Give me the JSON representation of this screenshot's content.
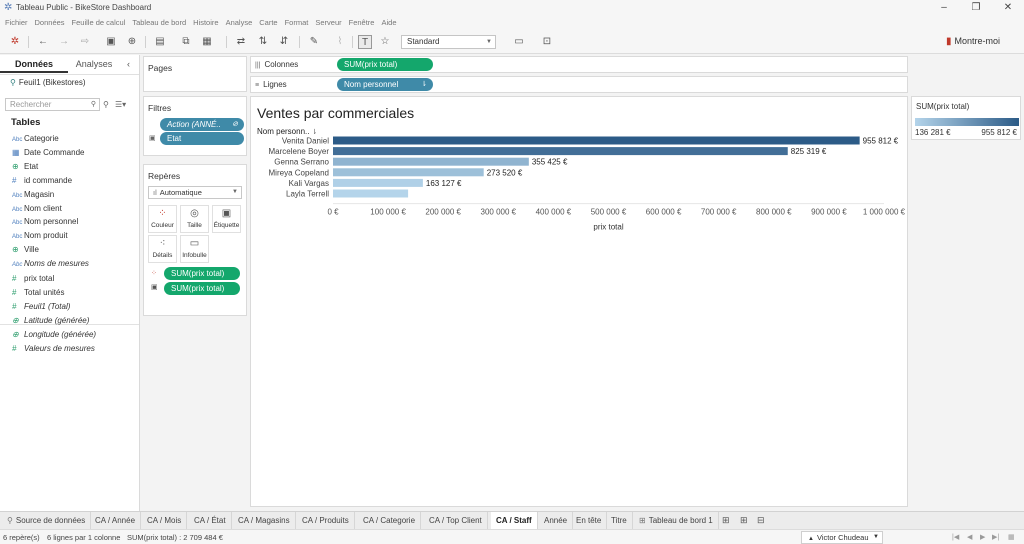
{
  "window": {
    "title": "Tableau Public - BikeStore Dashboard",
    "minimize": "–",
    "maximize": "❐",
    "close": "✕"
  },
  "menu": [
    "Fichier",
    "Données",
    "Feuille de calcul",
    "Tableau de bord",
    "Histoire",
    "Analyse",
    "Carte",
    "Format",
    "Serveur",
    "Fenêtre",
    "Aide"
  ],
  "toolbar": {
    "view_mode": "Standard",
    "show_me": "Montre-moi"
  },
  "data_pane": {
    "tab_data": "Données",
    "tab_analytics": "Analyses",
    "collapse": "‹",
    "datasource": "Feuil1 (Bikestores)",
    "search_placeholder": "Rechercher",
    "tables_label": "Tables",
    "dimensions": [
      {
        "type": "Abc",
        "name": "Categorie"
      },
      {
        "type": "date",
        "name": "Date Commande"
      },
      {
        "type": "geo",
        "name": "Etat"
      },
      {
        "type": "#",
        "name": "id commande"
      },
      {
        "type": "Abc",
        "name": "Magasin"
      },
      {
        "type": "Abc",
        "name": "Nom client"
      },
      {
        "type": "Abc",
        "name": "Nom personnel"
      },
      {
        "type": "Abc",
        "name": "Nom produit"
      },
      {
        "type": "geo",
        "name": "Ville"
      },
      {
        "type": "Abc",
        "name": "Noms de mesures",
        "italic": true
      }
    ],
    "measures": [
      {
        "type": "#",
        "name": "prix total"
      },
      {
        "type": "#",
        "name": "Total unités"
      },
      {
        "type": "#",
        "name": "Feuil1 (Total)",
        "italic": true
      },
      {
        "type": "geo",
        "name": "Latitude (générée)",
        "italic": true
      },
      {
        "type": "geo",
        "name": "Longitude (générée)",
        "italic": true
      },
      {
        "type": "#",
        "name": "Valeurs de mesures",
        "italic": true
      }
    ]
  },
  "cards": {
    "pages": "Pages",
    "filters": "Filtres",
    "filter_pills": [
      "Action (ANNÉ..",
      "Etat"
    ],
    "marks": "Repères",
    "marks_type": "Automatique",
    "mark_buttons": [
      "Couleur",
      "Taille",
      "Étiquette",
      "Détails",
      "Infobulle"
    ],
    "marks_pills": [
      "SUM(prix total)",
      "SUM(prix total)"
    ]
  },
  "shelves": {
    "columns_label": "Colonnes",
    "rows_label": "Lignes",
    "columns_pill": "SUM(prix total)",
    "rows_pill": "Nom personnel"
  },
  "sheet": {
    "title": "Ventes par commerciales",
    "row_header": "Nom personn.."
  },
  "chart_data": {
    "type": "bar",
    "orientation": "horizontal",
    "title": "Ventes par commerciales",
    "categories": [
      "Venita Daniel",
      "Marcelene Boyer",
      "Genna Serrano",
      "Mireya Copeland",
      "Kali Vargas",
      "Layla Terrell"
    ],
    "values": [
      955812,
      825319,
      355425,
      273520,
      163127,
      136281
    ],
    "data_labels": [
      "955 812 €",
      "825 319 €",
      "355 425 €",
      "273 520 €",
      "163 127 €",
      ""
    ],
    "xlabel": "prix total",
    "ylabel": "Nom personn..",
    "xlim": [
      0,
      1000000
    ],
    "xticks": [
      0,
      100000,
      200000,
      300000,
      400000,
      500000,
      600000,
      700000,
      800000,
      900000,
      1000000
    ],
    "xtick_labels": [
      "0 €",
      "100 000 €",
      "200 000 €",
      "300 000 €",
      "400 000 €",
      "500 000 €",
      "600 000 €",
      "700 000 €",
      "800 000 €",
      "900 000 €",
      "1 000 000 €"
    ],
    "color_min": "#b4d4ea",
    "color_max": "#2c5b87",
    "grid": false
  },
  "legend": {
    "title": "SUM(prix total)",
    "min": "136 281 €",
    "max": "955 812 €"
  },
  "sheet_tabs": {
    "source": "Source de données",
    "tabs": [
      "CA / Année",
      "CA / Mois",
      "CA / État",
      "CA / Magasins",
      "CA / Produits",
      "CA / Categorie",
      "CA / Top Client",
      "CA / Staff",
      "Année",
      "En tête",
      "Titre",
      "Tableau de bord 1"
    ],
    "active": "CA / Staff"
  },
  "status": {
    "marks": "6 repère(s)",
    "rows": "6 lignes par 1 colonne",
    "sum": "SUM(prix total) : 2 709 484 €",
    "user": "Victor Chudeau"
  }
}
